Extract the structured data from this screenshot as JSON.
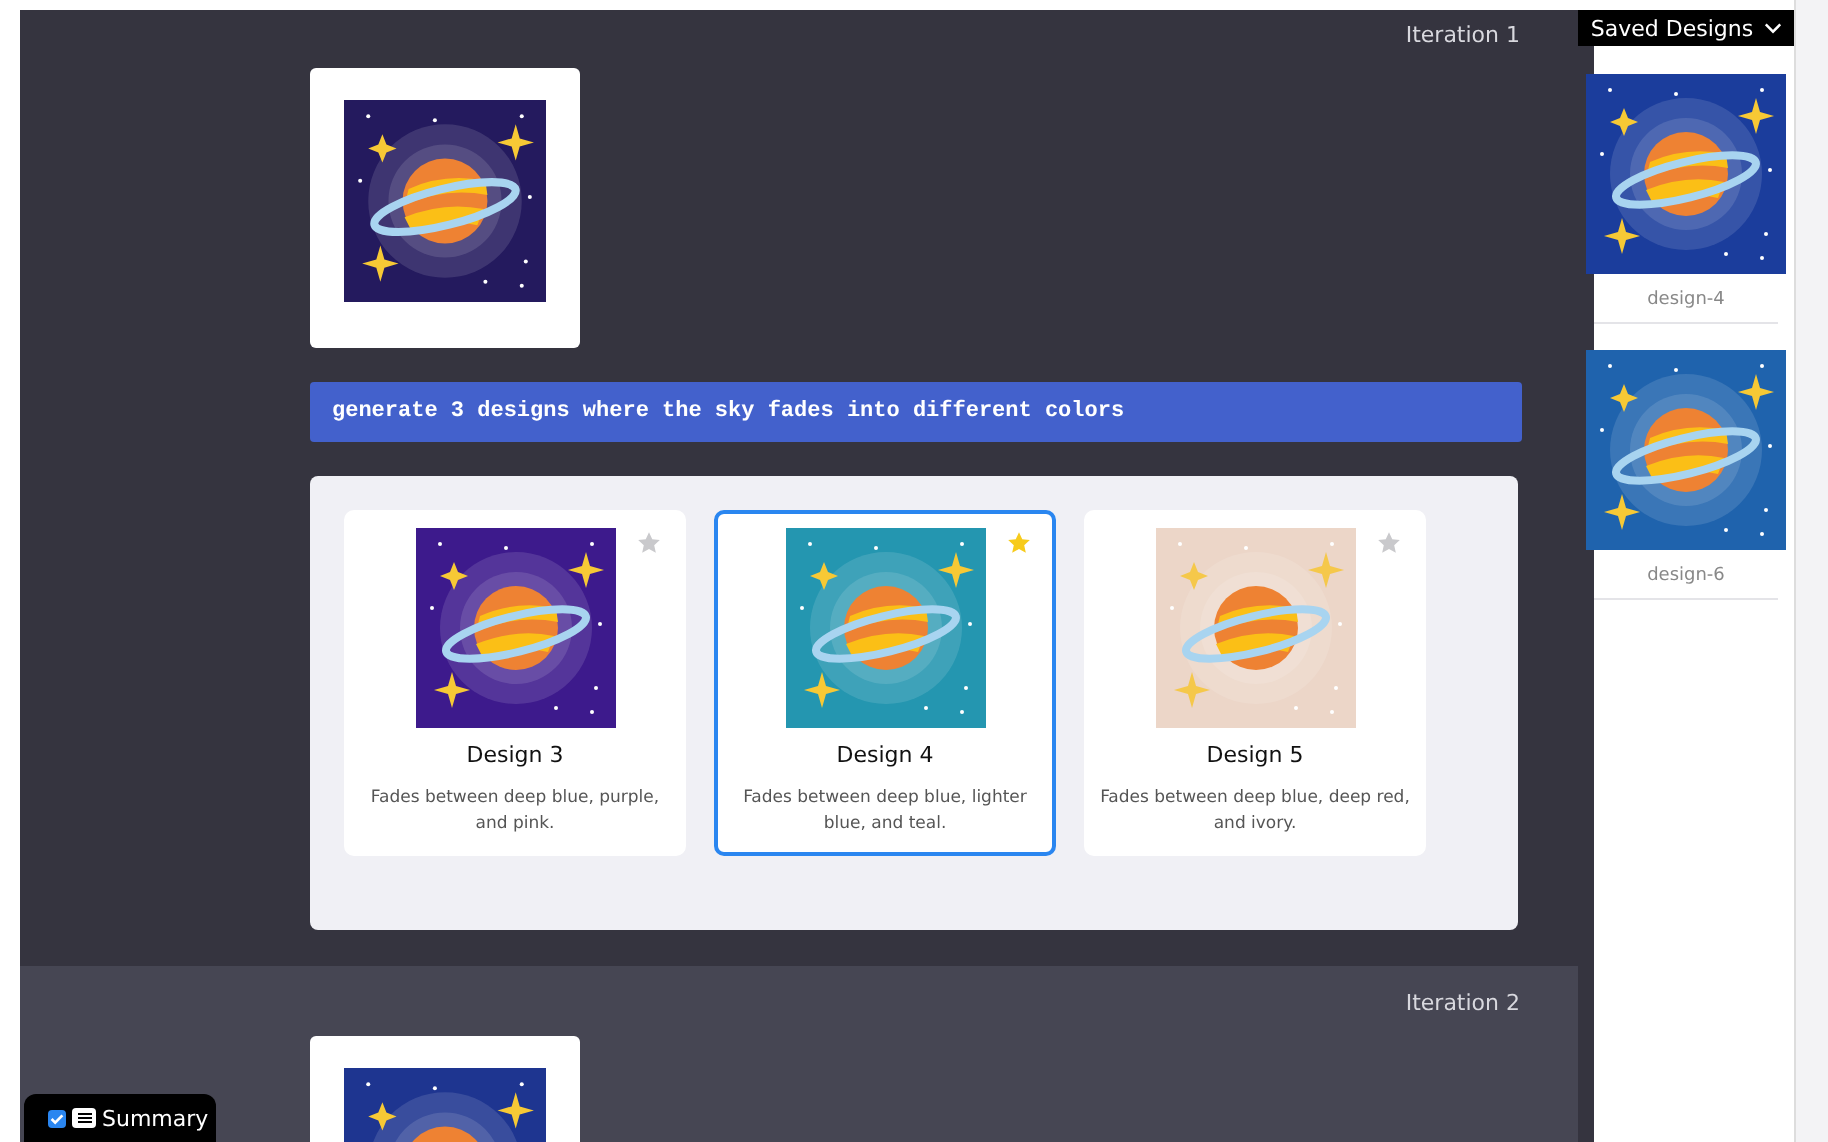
{
  "iterations": [
    {
      "label": "Iteration 1",
      "source_image": {
        "color": "#241a5e"
      },
      "prompt": "generate 3 designs where the sky fades into different colors",
      "designs": [
        {
          "title": "Design 3",
          "description": "Fades between deep blue, purple, and pink.",
          "color": "#3d1a8c",
          "starred": false,
          "selected": false
        },
        {
          "title": "Design 4",
          "description": "Fades between deep blue, lighter blue, and teal.",
          "color": "#2496b0",
          "starred": true,
          "selected": true
        },
        {
          "title": "Design 5",
          "description": "Fades between deep blue, deep red, and ivory.",
          "color": "#ecd6c8",
          "starred": false,
          "selected": false
        }
      ]
    },
    {
      "label": "Iteration 2",
      "source_image": {
        "color": "#1e3590"
      }
    }
  ],
  "saved_designs": {
    "title": "Saved Designs",
    "items": [
      {
        "label": "design-4",
        "color": "#1b3d9c"
      },
      {
        "label": "design-6",
        "color": "#1f63ad"
      }
    ]
  },
  "summary": {
    "label": "Summary",
    "checked": true
  }
}
